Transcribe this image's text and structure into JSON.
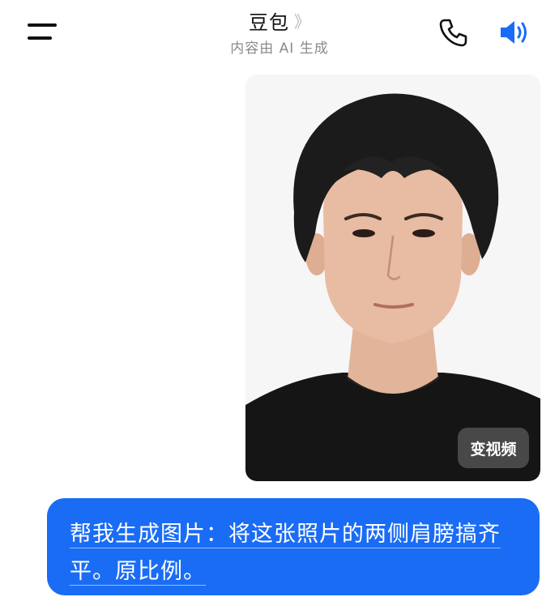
{
  "header": {
    "title": "豆包",
    "chevron": "》",
    "subtitle": "内容由 AI 生成",
    "icons": [
      "menu-icon",
      "phone-icon",
      "speaker-icon"
    ]
  },
  "message_image": {
    "video_button_label": "变视频"
  },
  "user_message": {
    "text": "帮我生成图片：将这张照片的两侧肩膀搞齐平。原比例。"
  },
  "colors": {
    "accent": "#1a6cf5",
    "bubble_text": "#ffffff",
    "title": "#111111",
    "subtitle": "#8a8a8a"
  }
}
